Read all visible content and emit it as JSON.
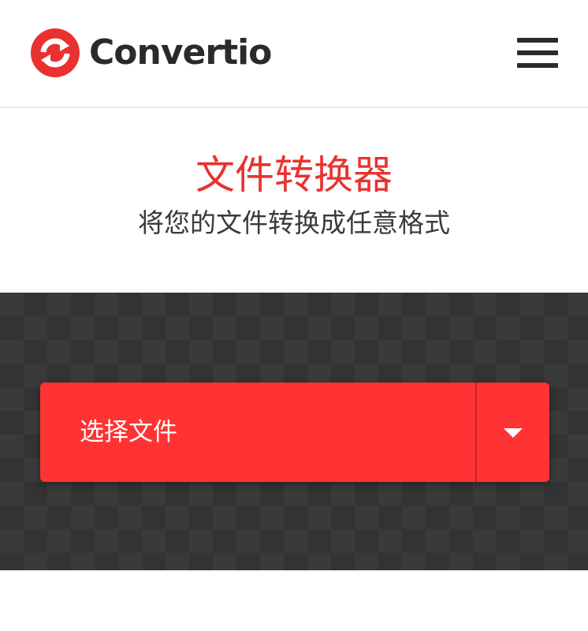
{
  "header": {
    "brand_name": "Convertio",
    "logo_icon": "convertio-logo-icon",
    "menu_icon": "hamburger-menu-icon"
  },
  "hero": {
    "title": "文件转换器",
    "subtitle": "将您的文件转换成任意格式"
  },
  "upload": {
    "choose_label": "选择文件",
    "dropdown_icon": "caret-down-icon"
  },
  "colors": {
    "brand_red": "#ff3333",
    "title_red": "#e9322f",
    "dropzone_dark": "#3a3a3a",
    "text_dark": "#2a2a2a"
  }
}
